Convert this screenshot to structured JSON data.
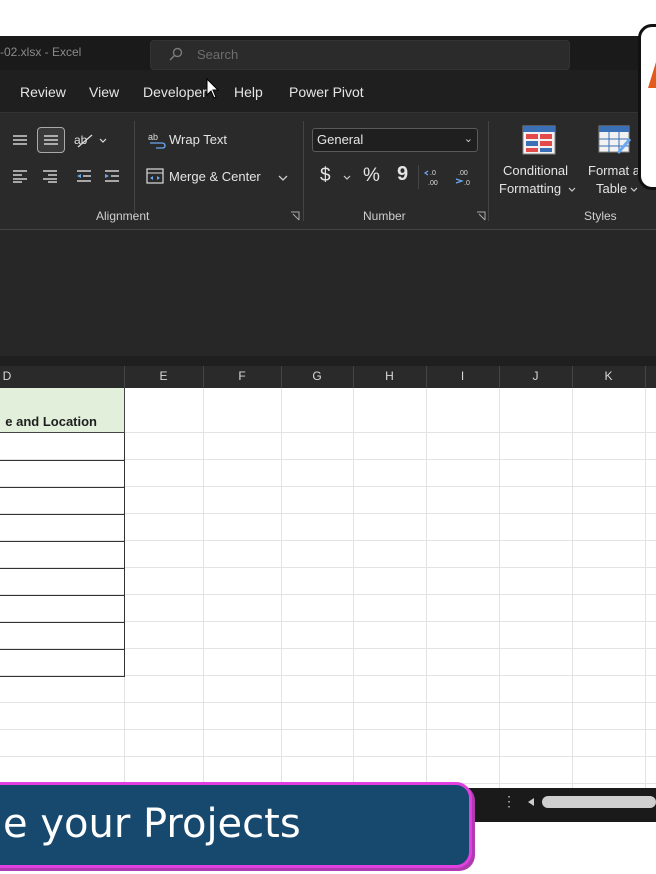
{
  "window": {
    "title": "-02.xlsx  -  Excel"
  },
  "search": {
    "placeholder": "Search"
  },
  "menu": {
    "tabs": [
      "Review",
      "View",
      "Developer",
      "Help",
      "Power Pivot"
    ]
  },
  "ribbon": {
    "alignment": {
      "wrap_text": "Wrap Text",
      "merge_center": "Merge & Center",
      "label": "Alignment"
    },
    "number": {
      "format_value": "General",
      "currency": "$",
      "percent": "%",
      "comma": "9",
      "label": "Number"
    },
    "styles": {
      "conditional_line1": "Conditional",
      "conditional_line2": "Formatting",
      "format_table_line1": "Format a",
      "format_table_line2": "Table",
      "label": "Styles"
    }
  },
  "columns": [
    "D",
    "E",
    "F",
    "G",
    "H",
    "I",
    "J",
    "K"
  ],
  "table": {
    "header": "e and Location"
  },
  "banner": {
    "text": "e your Projects"
  },
  "colors": {
    "accent_orange": "#e35b1a",
    "banner_bg": "#17486d",
    "banner_border": "#e040e0",
    "header_fill": "#e2efda"
  }
}
